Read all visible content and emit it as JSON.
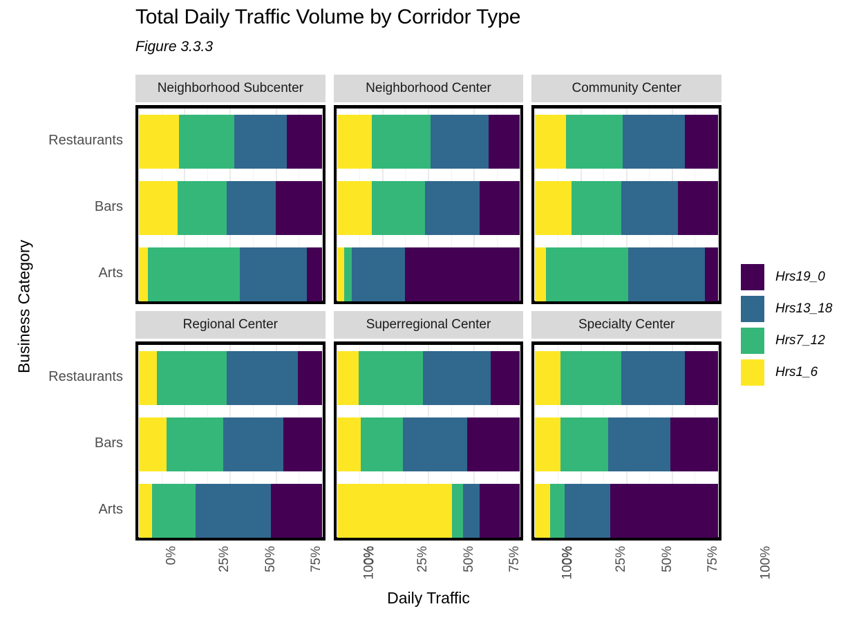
{
  "title": "Total Daily Traffic Volume by Corridor Type",
  "subtitle": "Figure 3.3.3",
  "axes": {
    "x_title": "Daily Traffic",
    "y_title": "Business Category",
    "x_ticks": [
      "0%",
      "25%",
      "50%",
      "75%",
      "100%"
    ],
    "y_ticks": [
      "Restaurants",
      "Bars",
      "Arts"
    ]
  },
  "legend": {
    "items": [
      {
        "label": "Hrs19_0",
        "color": "#440154"
      },
      {
        "label": "Hrs13_18",
        "color": "#31688e"
      },
      {
        "label": "Hrs7_12",
        "color": "#35b779"
      },
      {
        "label": "Hrs1_6",
        "color": "#fde725"
      }
    ]
  },
  "chart_data": {
    "type": "bar",
    "subtype": "stacked-horizontal-100pct",
    "title": "Total Daily Traffic Volume by Corridor Type",
    "subtitle": "Figure 3.3.3",
    "xlabel": "Daily Traffic",
    "ylabel": "Business Category",
    "xlim": [
      0,
      100
    ],
    "x_tick_values": [
      0,
      25,
      50,
      75,
      100
    ],
    "grid": true,
    "legend_position": "right",
    "categories": [
      "Restaurants",
      "Bars",
      "Arts"
    ],
    "series_order": [
      "Hrs1_6",
      "Hrs7_12",
      "Hrs13_18",
      "Hrs19_0"
    ],
    "series_colors": {
      "Hrs1_6": "#fde725",
      "Hrs7_12": "#35b779",
      "Hrs13_18": "#31688e",
      "Hrs19_0": "#440154"
    },
    "facet_variable": "Corridor Type",
    "facets": [
      {
        "name": "Neighborhood Subcenter",
        "rows": [
          {
            "category": "Restaurants",
            "values": {
              "Hrs1_6": 22,
              "Hrs7_12": 30,
              "Hrs13_18": 29,
              "Hrs19_0": 19
            }
          },
          {
            "category": "Bars",
            "values": {
              "Hrs1_6": 21,
              "Hrs7_12": 27,
              "Hrs13_18": 27,
              "Hrs19_0": 25
            }
          },
          {
            "category": "Arts",
            "values": {
              "Hrs1_6": 5,
              "Hrs7_12": 50,
              "Hrs13_18": 37,
              "Hrs19_0": 8
            }
          }
        ]
      },
      {
        "name": "Neighborhood Center",
        "rows": [
          {
            "category": "Restaurants",
            "values": {
              "Hrs1_6": 19,
              "Hrs7_12": 32,
              "Hrs13_18": 32,
              "Hrs19_0": 17
            }
          },
          {
            "category": "Bars",
            "values": {
              "Hrs1_6": 19,
              "Hrs7_12": 29,
              "Hrs13_18": 30,
              "Hrs19_0": 22
            }
          },
          {
            "category": "Arts",
            "values": {
              "Hrs1_6": 4,
              "Hrs7_12": 4,
              "Hrs13_18": 29,
              "Hrs19_0": 63
            }
          }
        ]
      },
      {
        "name": "Community Center",
        "rows": [
          {
            "category": "Restaurants",
            "values": {
              "Hrs1_6": 17,
              "Hrs7_12": 31,
              "Hrs13_18": 34,
              "Hrs19_0": 18
            }
          },
          {
            "category": "Bars",
            "values": {
              "Hrs1_6": 20,
              "Hrs7_12": 27,
              "Hrs13_18": 31,
              "Hrs19_0": 22
            }
          },
          {
            "category": "Arts",
            "values": {
              "Hrs1_6": 6,
              "Hrs7_12": 45,
              "Hrs13_18": 42,
              "Hrs19_0": 7
            }
          }
        ]
      },
      {
        "name": "Regional Center",
        "rows": [
          {
            "category": "Restaurants",
            "values": {
              "Hrs1_6": 10,
              "Hrs7_12": 38,
              "Hrs13_18": 39,
              "Hrs19_0": 13
            }
          },
          {
            "category": "Bars",
            "values": {
              "Hrs1_6": 15,
              "Hrs7_12": 31,
              "Hrs13_18": 33,
              "Hrs19_0": 21
            }
          },
          {
            "category": "Arts",
            "values": {
              "Hrs1_6": 7,
              "Hrs7_12": 24,
              "Hrs13_18": 41,
              "Hrs19_0": 28
            }
          }
        ]
      },
      {
        "name": "Superregional Center",
        "rows": [
          {
            "category": "Restaurants",
            "values": {
              "Hrs1_6": 12,
              "Hrs7_12": 35,
              "Hrs13_18": 37,
              "Hrs19_0": 16
            }
          },
          {
            "category": "Bars",
            "values": {
              "Hrs1_6": 13,
              "Hrs7_12": 23,
              "Hrs13_18": 35,
              "Hrs19_0": 29
            }
          },
          {
            "category": "Arts",
            "values": {
              "Hrs1_6": 63,
              "Hrs7_12": 6,
              "Hrs13_18": 9,
              "Hrs19_0": 22
            }
          }
        ]
      },
      {
        "name": "Specialty Center",
        "rows": [
          {
            "category": "Restaurants",
            "values": {
              "Hrs1_6": 14,
              "Hrs7_12": 33,
              "Hrs13_18": 35,
              "Hrs19_0": 18
            }
          },
          {
            "category": "Bars",
            "values": {
              "Hrs1_6": 14,
              "Hrs7_12": 26,
              "Hrs13_18": 34,
              "Hrs19_0": 26
            }
          },
          {
            "category": "Arts",
            "values": {
              "Hrs1_6": 8,
              "Hrs7_12": 8,
              "Hrs13_18": 25,
              "Hrs19_0": 59
            }
          }
        ]
      }
    ]
  }
}
